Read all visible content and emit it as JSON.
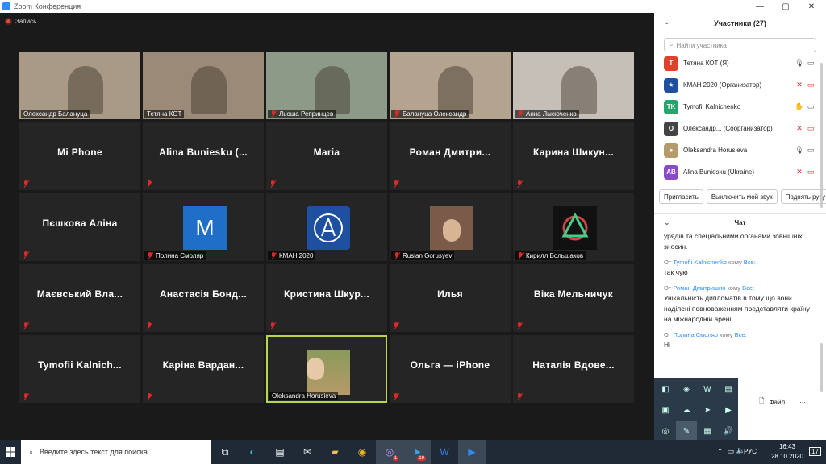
{
  "window": {
    "title": "Zoom Конференция"
  },
  "recording": {
    "label": "Запись"
  },
  "tiles": [
    {
      "label": "Олександр Балануца",
      "video": true,
      "color": "#a89a86",
      "muted": false
    },
    {
      "label": "Тетяна КОТ",
      "video": true,
      "color": "#9c8a78",
      "muted": false
    },
    {
      "label": "Льоша Репринцев",
      "video": true,
      "color": "#8d9a88",
      "muted": true
    },
    {
      "label": "Балануца Олександр",
      "video": true,
      "color": "#b3a38f",
      "muted": true
    },
    {
      "label": "Анна Лысюченко",
      "video": true,
      "color": "#c6bfb7",
      "muted": true
    },
    {
      "name": "Mi Phone",
      "muted": true
    },
    {
      "name": "Alina  Buniesku  (...",
      "muted": true
    },
    {
      "name": "Maria",
      "muted": true
    },
    {
      "name": "Роман  Дмитри...",
      "muted": true
    },
    {
      "name": "Карина  Шикун...",
      "muted": true
    },
    {
      "name": "Пєшкова Аліна",
      "muted": true
    },
    {
      "label": "Полина Смоляр",
      "avatar": "M",
      "avatarColor": "#1f6fc8",
      "muted": true
    },
    {
      "label": "КМАН 2020",
      "avatar": "logo",
      "avatarColor": "#1f4fa0",
      "muted": true
    },
    {
      "label": "Ruslan Gorusyev",
      "avatar": "photo",
      "avatarColor": "#7a5a48",
      "muted": true
    },
    {
      "label": "Кирилл Большаков",
      "avatar": "knot",
      "avatarColor": "#111",
      "muted": true
    },
    {
      "name": "Маєвський  Вла...",
      "muted": true
    },
    {
      "name": "Анастасія  Бонд...",
      "muted": true
    },
    {
      "name": "Кристина  Шкур...",
      "muted": true
    },
    {
      "name": "Илья",
      "muted": true
    },
    {
      "name": "Віка  Мельничук",
      "muted": true
    },
    {
      "name": "Tymofii  Kalnich...",
      "muted": true
    },
    {
      "name": "Каріна  Вардан...",
      "muted": true
    },
    {
      "label": "Oleksandra Horusieva",
      "avatar": "photo2",
      "avatarColor": "#b59a6a",
      "muted": false,
      "speaker": true
    },
    {
      "name": "Ольга — iPhone",
      "muted": true
    },
    {
      "name": "Наталія  Вдове...",
      "muted": true
    }
  ],
  "participants": {
    "title": "Участники (27)",
    "search_placeholder": "Найти участника",
    "list": [
      {
        "initials": "Т",
        "name": "Тетяна КОТ (Я)",
        "color": "#e0412a",
        "mic": "🎙",
        "cam": "▭"
      },
      {
        "initials": "★",
        "name": "КМАН 2020 (Организатор)",
        "color": "#1f4fa0",
        "mic": "✕",
        "cam": "▭"
      },
      {
        "initials": "TK",
        "name": "Tymofii Kalnichenko",
        "color": "#25a56a",
        "mic": "✋",
        "cam": "▭"
      },
      {
        "initials": "О",
        "name": "Олександр... (Соорганизатор)",
        "color": "#444",
        "mic": "✕",
        "cam": "▭"
      },
      {
        "initials": "●",
        "name": "Oleksandra Horusieva",
        "color": "#b59a6a",
        "mic": "🎙",
        "cam": "▭"
      },
      {
        "initials": "AB",
        "name": "Alina Buniesku (Ukraine)",
        "color": "#8c49c9",
        "mic": "✕",
        "cam": "▭"
      }
    ],
    "buttons": [
      "Пригласить",
      "Выключить мой звук",
      "Поднять руку"
    ]
  },
  "chat": {
    "title": "Чат",
    "messages": [
      {
        "text": "урядів та спеціальними органами зовнішніх зносин."
      },
      {
        "from": "Tymofii Kalnichenko",
        "to": "Все:",
        "text": "так чую"
      },
      {
        "from": "Роман Дмитришин",
        "to": "Все:",
        "text": "Унікальність дипломатів в тому що вони наділені повноваженням представляти країну на міжнародній арені."
      },
      {
        "from": "Полина Смоляр",
        "to": "Все:",
        "text": "Ні"
      }
    ],
    "from_word": "От",
    "to_word": "кому",
    "file_label": "Файл"
  },
  "taskbar": {
    "search_placeholder": "Введите здесь текст для поиска",
    "lang": "РУС",
    "time": "16:43",
    "date": "28.10.2020",
    "notif": "17",
    "viber_badge": "1",
    "telegram_badge": "19"
  }
}
